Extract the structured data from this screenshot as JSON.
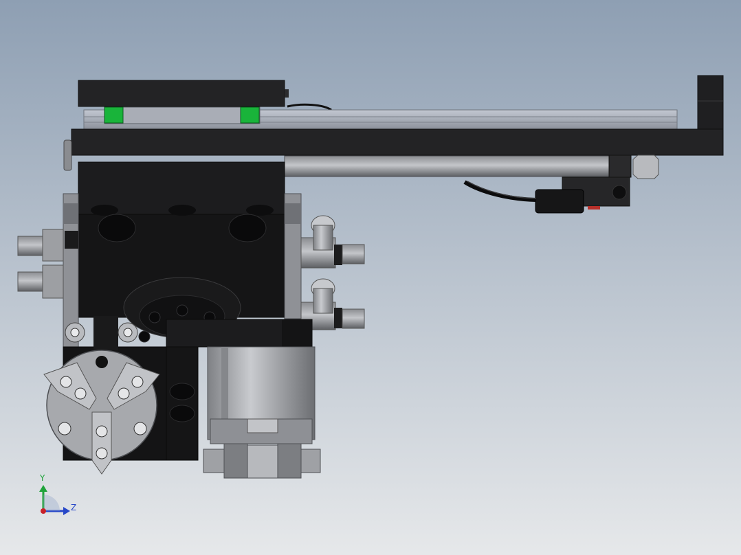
{
  "viewport": {
    "background_top": "#8e9fb3",
    "background_bottom": "#e6e8ea"
  },
  "triad": {
    "y_label": "Y",
    "z_label": "Z",
    "y_color": "#1fa33a",
    "z_color": "#2747c8",
    "origin_color": "#c8202a"
  },
  "model": {
    "body_color": "#1f1f21",
    "steel_color": "#9c9ea3",
    "rail_color": "#a6abb6",
    "green_color": "#19b43a",
    "dark_steel": "#58595c"
  }
}
